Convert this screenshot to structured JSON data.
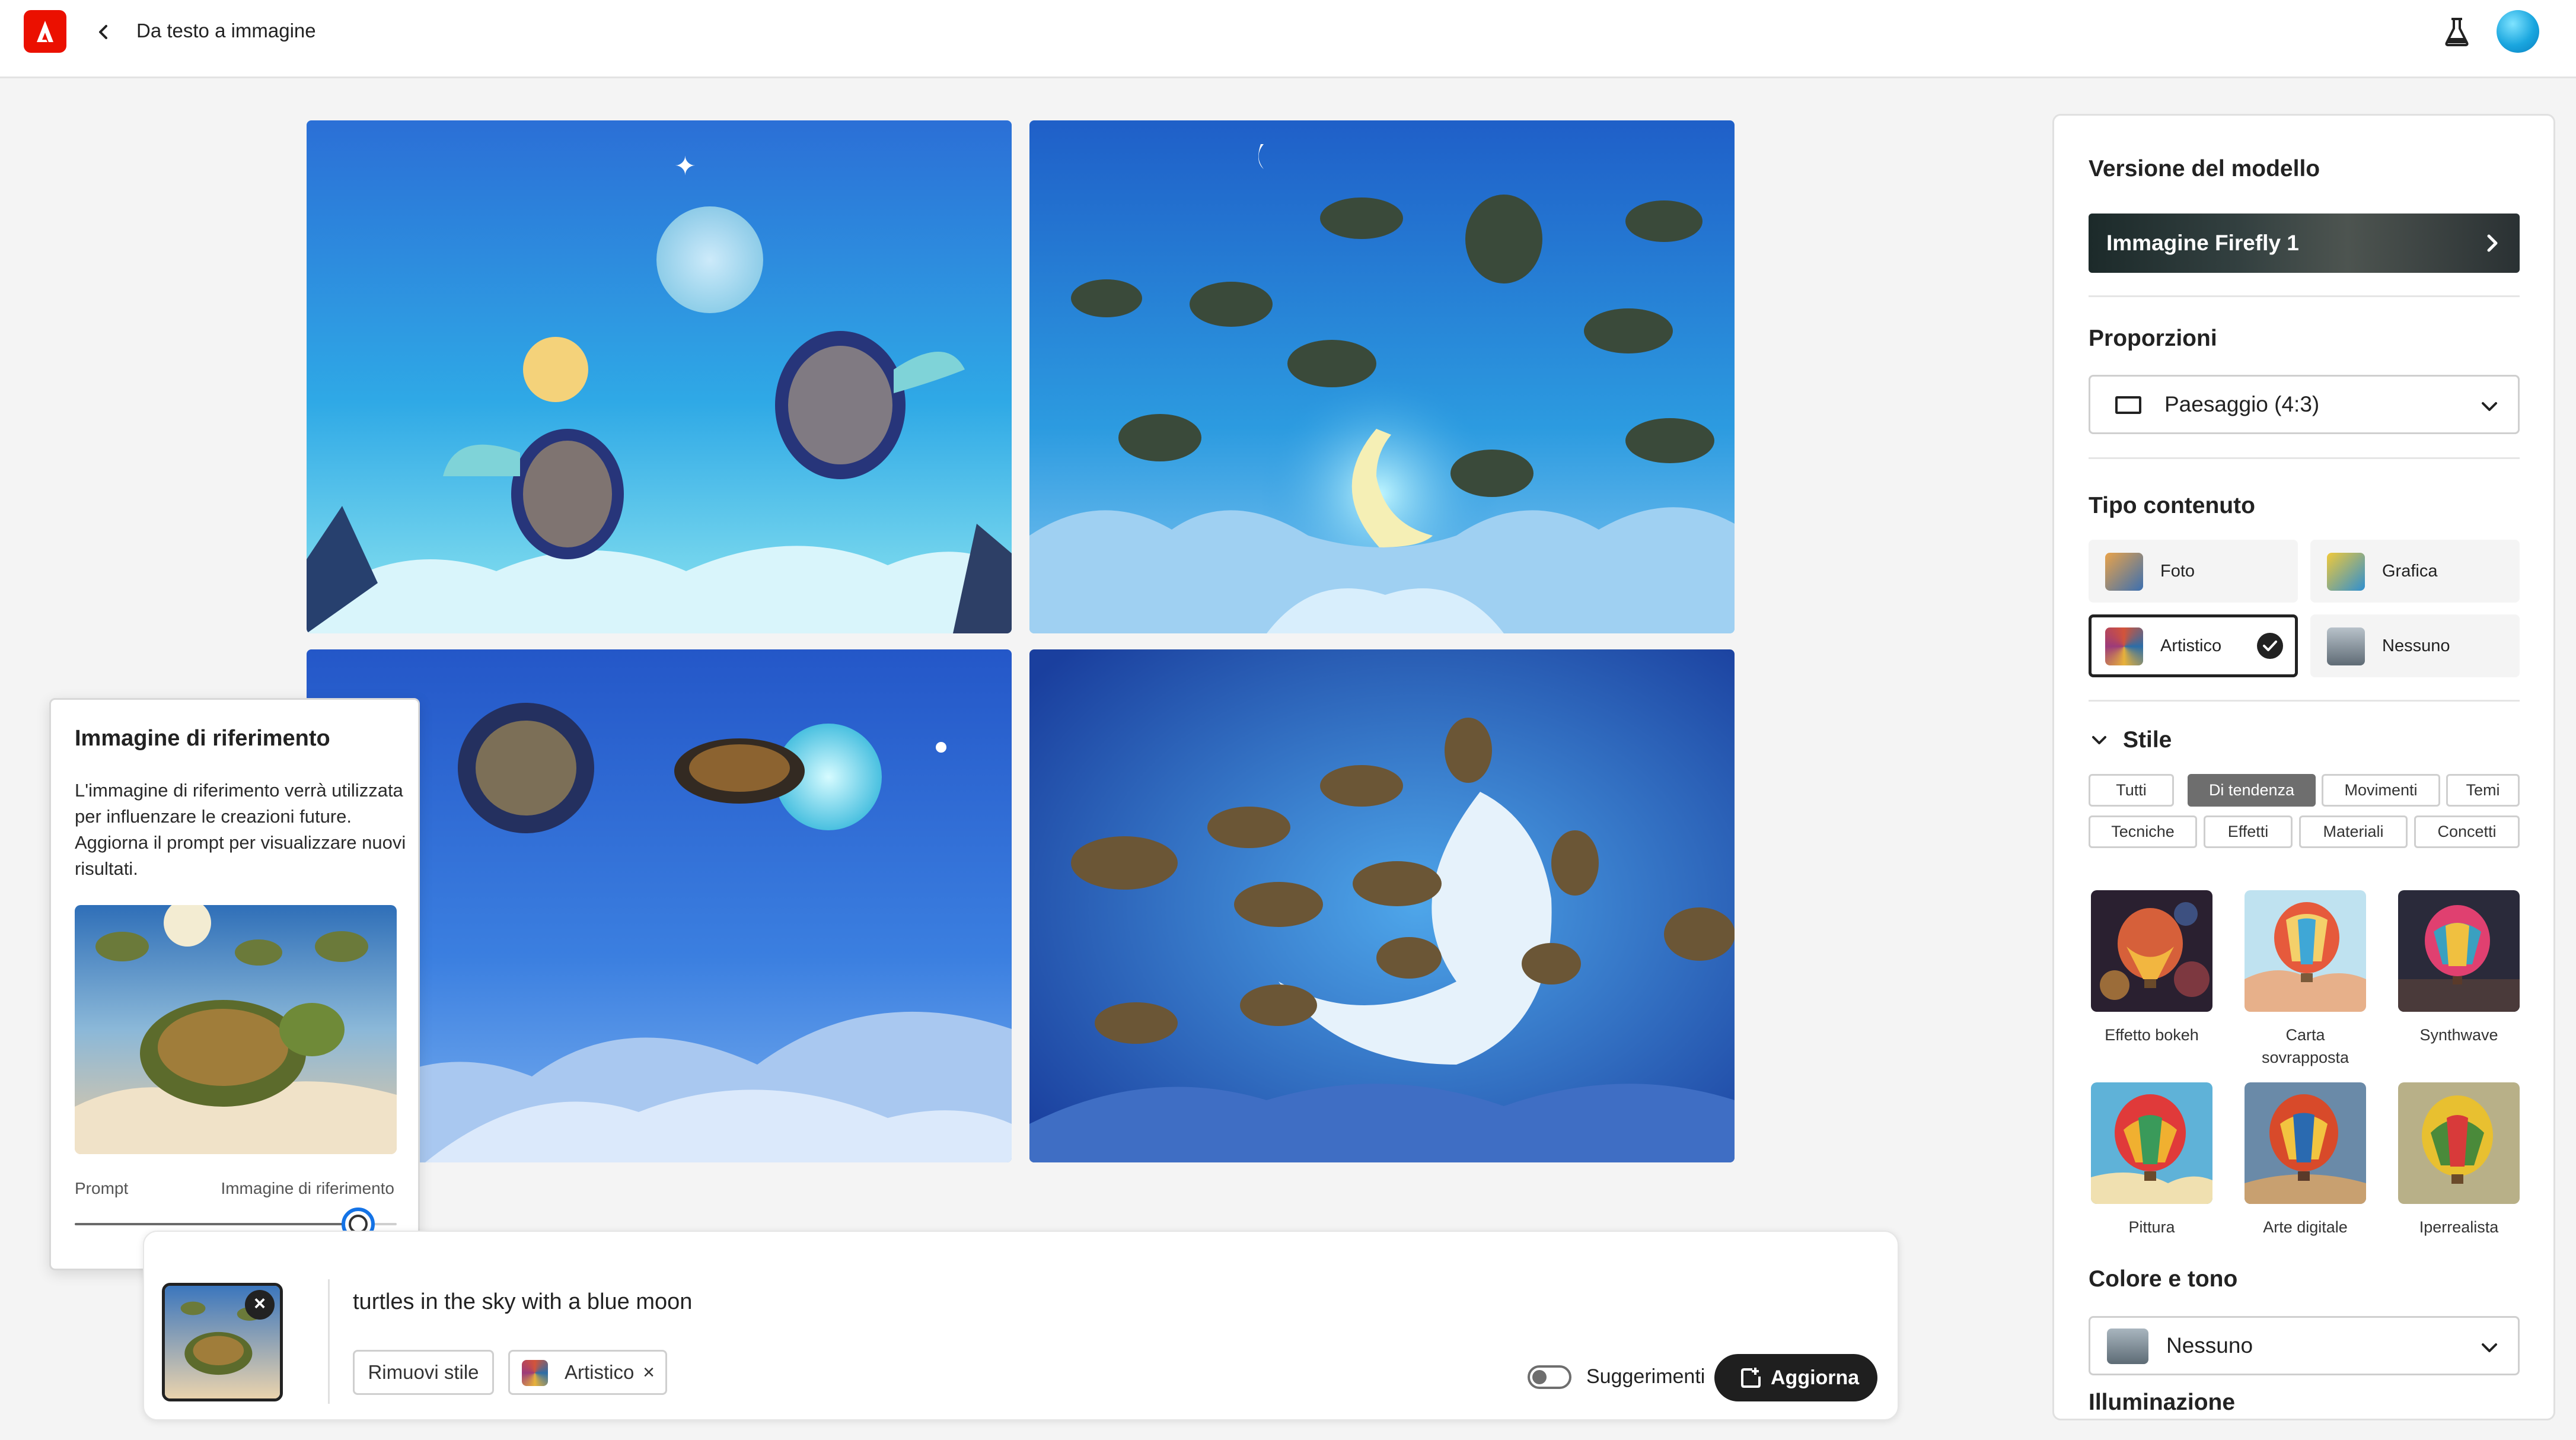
{
  "topbar": {
    "title": "Da testo a immagine"
  },
  "reference_popover": {
    "title": "Immagine di riferimento",
    "description": "L'immagine di riferimento verrà utilizzata per influenzare le creazioni future. Aggiorna il prompt per visualizzare nuovi risultati.",
    "slider_left_label": "Prompt",
    "slider_right_label": "Immagine di riferimento",
    "slider_value": 0.88
  },
  "prompt_bar": {
    "prompt_text": "turtles in the sky with a blue moon",
    "remove_style_label": "Rimuovi stile",
    "style_chip_label": "Artistico",
    "suggestions_label": "Suggerimenti",
    "suggestions_on": false,
    "update_label": "Aggiorna"
  },
  "panel": {
    "model_heading": "Versione del modello",
    "model_value": "Immagine Firefly 1",
    "proportions_heading": "Proporzioni",
    "proportions_value": "Paesaggio (4:3)",
    "content_type_heading": "Tipo contenuto",
    "content_types": [
      {
        "label": "Foto",
        "selected": false
      },
      {
        "label": "Grafica",
        "selected": false
      },
      {
        "label": "Artistico",
        "selected": true
      },
      {
        "label": "Nessuno",
        "selected": false
      }
    ],
    "style_heading": "Stile",
    "style_tags": [
      {
        "label": "Tutti",
        "active": false
      },
      {
        "label": "Di tendenza",
        "active": true
      },
      {
        "label": "Movimenti",
        "active": false
      },
      {
        "label": "Temi",
        "active": false
      },
      {
        "label": "Tecniche",
        "active": false
      },
      {
        "label": "Effetti",
        "active": false
      },
      {
        "label": "Materiali",
        "active": false
      },
      {
        "label": "Concetti",
        "active": false
      }
    ],
    "styles": [
      {
        "label": "Effetto bokeh"
      },
      {
        "label": "Carta sovrapposta"
      },
      {
        "label": "Synthwave"
      },
      {
        "label": "Pittura"
      },
      {
        "label": "Arte digitale"
      },
      {
        "label": "Iperrealista"
      }
    ],
    "color_heading": "Colore e tono",
    "color_value": "Nessuno",
    "lighting_heading": "Illuminazione"
  },
  "colors": {
    "accent": "#1473e6",
    "adobe_red": "#eb1000",
    "dark_button": "#1f1f1f"
  },
  "icons": [
    "adobe-logo",
    "chevron-left-icon",
    "labs-flask-icon",
    "avatar",
    "close-icon",
    "chevron-right-icon",
    "chevron-down-icon",
    "landscape-ratio-icon",
    "checkmark-icon",
    "chevron-collapse-icon",
    "update-icon"
  ]
}
